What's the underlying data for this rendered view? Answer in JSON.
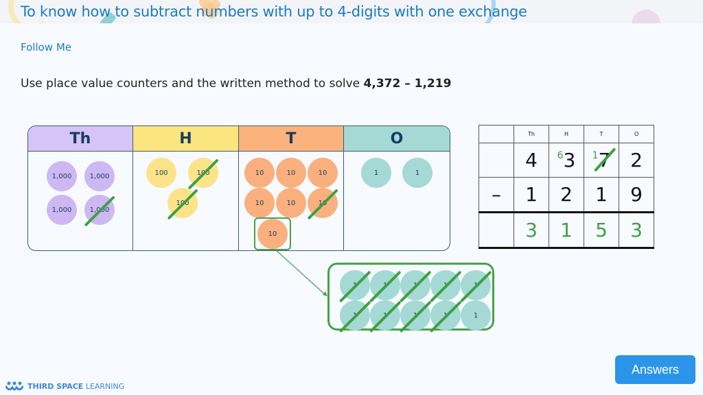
{
  "header": {
    "title": "To know how to subtract numbers with up to 4-digits with one exchange"
  },
  "section_label": "Follow Me",
  "question": {
    "text": "Use place value counters and the written method to solve ",
    "expression": "4,372 – 1,219"
  },
  "place_value_chart": {
    "columns": [
      {
        "label": "Th",
        "color": "#d6c4f7",
        "counter_color": "#cdb8f3",
        "counter_value": "1,000",
        "count": 4,
        "crossed": 1
      },
      {
        "label": "H",
        "color": "#fbe57e",
        "counter_color": "#fbe38a",
        "counter_value": "100",
        "count": 3,
        "crossed": 2
      },
      {
        "label": "T",
        "color": "#fbb37e",
        "counter_color": "#f9b07e",
        "counter_value": "10",
        "count": 7,
        "crossed": 1,
        "exchanged": 1
      },
      {
        "label": "O",
        "color": "#a5d9d5",
        "counter_color": "#a5d9d5",
        "counter_value": "1",
        "count": 2,
        "crossed": 0
      }
    ]
  },
  "exchange": {
    "counter_value": "1",
    "count": 10,
    "crossed": 9
  },
  "written_method": {
    "headers": [
      "",
      "Th",
      "H",
      "T",
      "O"
    ],
    "top_row": {
      "sign": "",
      "digits": [
        "4",
        "3",
        "7",
        "2"
      ],
      "exchange_marks": {
        "H": "6",
        "T": "1"
      },
      "crossed_column": "T"
    },
    "subtract_row": {
      "sign": "–",
      "digits": [
        "1",
        "2",
        "1",
        "9"
      ]
    },
    "answer_row": {
      "sign": "",
      "digits": [
        "3",
        "1",
        "5",
        "3"
      ]
    }
  },
  "footer": {
    "logo_bold": "THIRD SPACE",
    "logo_light": "LEARNING",
    "answers_button": "Answers"
  },
  "colors": {
    "title": "#1a7cc1",
    "strike": "#3fa043",
    "button": "#2b95ea"
  }
}
